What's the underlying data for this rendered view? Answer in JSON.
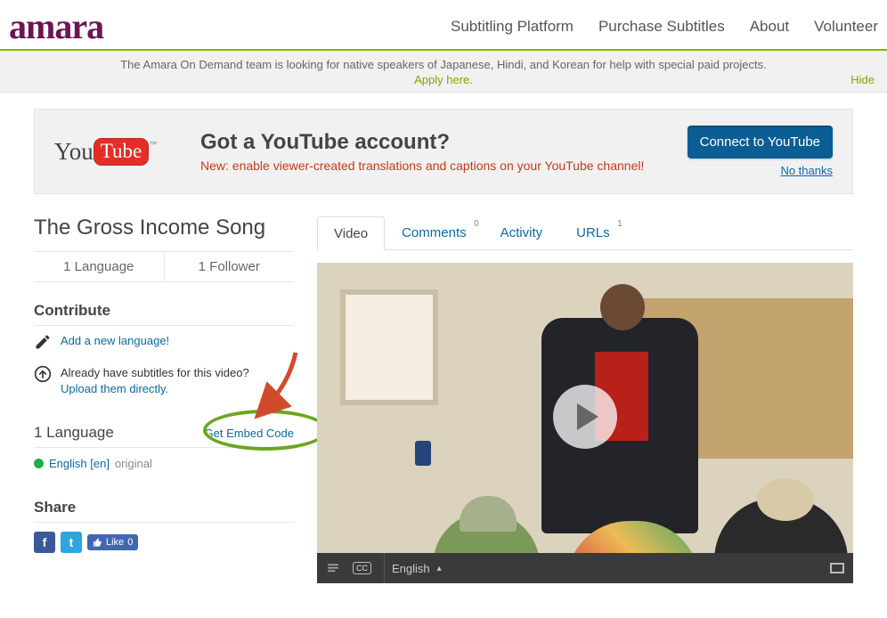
{
  "brand": "amara",
  "nav": {
    "subtitling": "Subtitling Platform",
    "purchase": "Purchase Subtitles",
    "about": "About",
    "volunteer": "Volunteer"
  },
  "notice": {
    "text": "The Amara On Demand team is looking for native speakers of Japanese, Hindi, and Korean for help with special paid projects.",
    "apply": "Apply here.",
    "hide": "Hide"
  },
  "promo": {
    "yt_you": "You",
    "yt_tube": "Tube",
    "tm": "™",
    "heading": "Got a YouTube account?",
    "sub": "New: enable viewer-created translations and captions on your YouTube channel!",
    "connect": "Connect to YouTube",
    "no_thanks": "No thanks"
  },
  "page": {
    "title": "The Gross Income Song",
    "stat_lang": "1 Language",
    "stat_follow": "1 Follower"
  },
  "contribute": {
    "heading": "Contribute",
    "add_lang": "Add a new language!",
    "already": "Already have subtitles for this video?",
    "upload": "Upload them directly."
  },
  "langs": {
    "heading": "1 Language",
    "embed": "Get Embed Code",
    "english_link": "English [en]",
    "english_orig": "original"
  },
  "share": {
    "heading": "Share",
    "like": "Like",
    "like_count": "0"
  },
  "tabs": {
    "video": "Video",
    "comments": "Comments",
    "comments_n": "0",
    "activity": "Activity",
    "urls": "URLs",
    "urls_n": "1"
  },
  "player": {
    "cc": "CC",
    "lang": "English",
    "arrow": "▴"
  }
}
